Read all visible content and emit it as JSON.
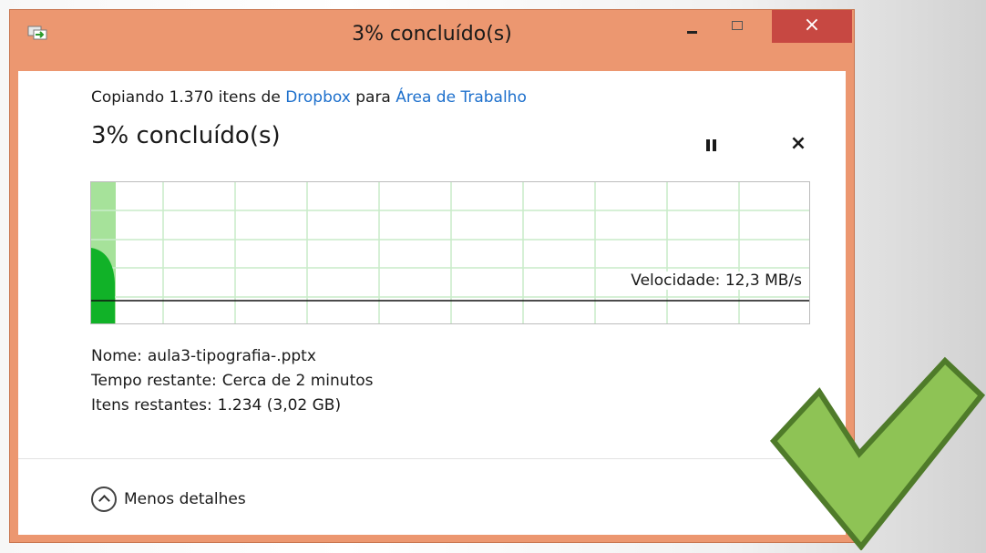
{
  "window": {
    "title": "3% concluído(s)",
    "close_symbol": "×",
    "accent_color": "#ec9770",
    "close_color": "#c74842"
  },
  "copy": {
    "prefix": "Copiando 1.370 itens de ",
    "source": "Dropbox",
    "middle": " para ",
    "destination": "Área de Trabalho"
  },
  "progress": {
    "title": "3% concluído(s)",
    "percent": 3,
    "speed_label": "Velocidade: 12,3 MB/s",
    "stop_symbol": "×"
  },
  "details": {
    "name_key": "Nome:",
    "name_value": "aula3-tipografia-.pptx",
    "time_key": "Tempo restante:",
    "time_value": "Cerca de 2 minutos",
    "items_key": "Itens restantes:",
    "items_value": "1.234 (3,02 GB)"
  },
  "footer": {
    "less_details_label": "Menos detalhes"
  },
  "icons": {
    "title": "copy-icon",
    "pause": "pause-icon",
    "stop": "close-icon",
    "collapse": "chevron-up-icon",
    "decoration": "checkmark-icon"
  },
  "colors": {
    "progress_fill": "#a6e29a",
    "speed_fill": "#11b228",
    "grid": "#c9ecc9",
    "link": "#1c6fcc",
    "checkmark": "#8ec355"
  }
}
